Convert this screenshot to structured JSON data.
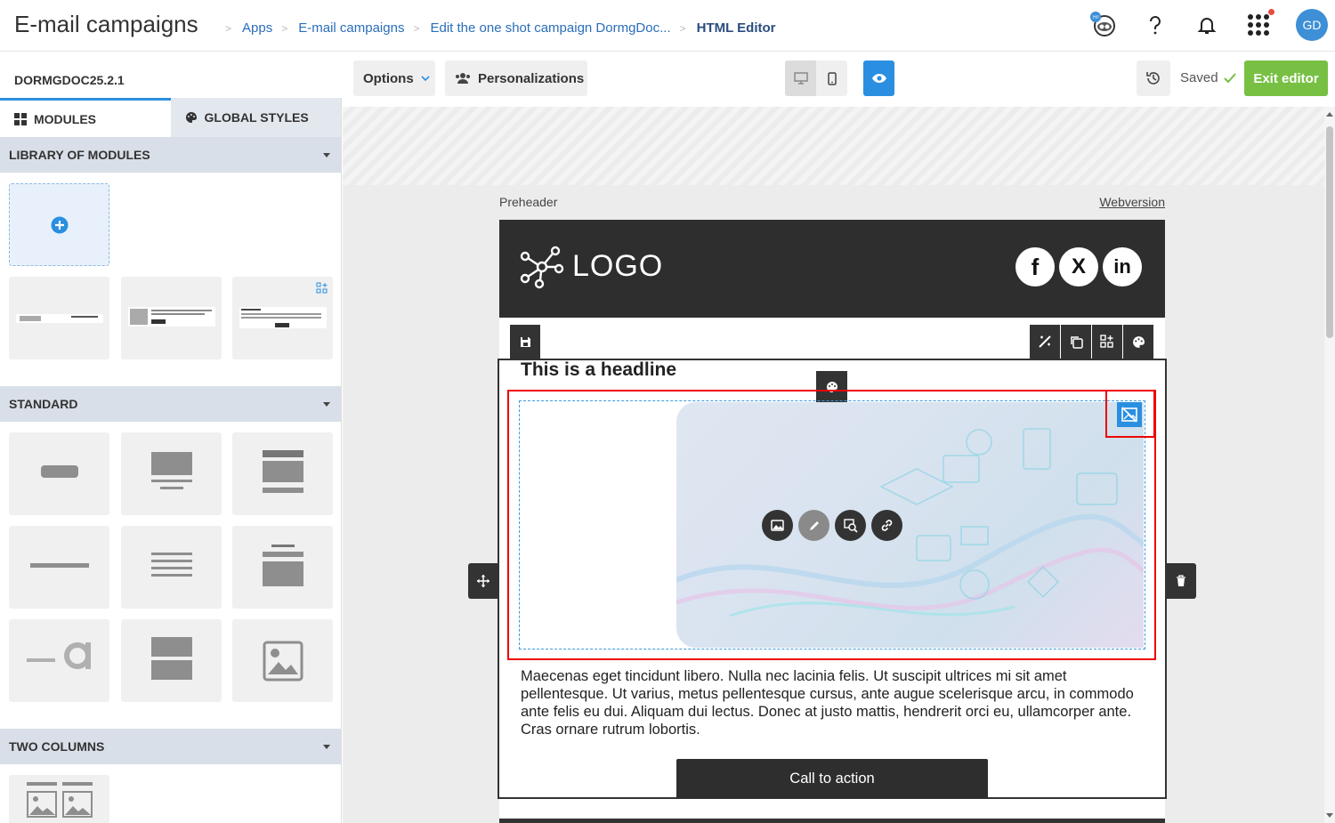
{
  "header": {
    "app_title": "E-mail campaigns",
    "breadcrumb": [
      "Apps",
      "E-mail campaigns",
      "Edit the one shot campaign DormgDoc...",
      "HTML Editor"
    ],
    "avatar_initials": "GD",
    "notification_badge_color": "#e74c3c"
  },
  "toolbar": {
    "campaign_code": "DORMGDOC25.2.1",
    "options_label": "Options",
    "personalizations_label": "Personalizations",
    "saved_label": "Saved",
    "exit_label": "Exit editor",
    "accent_color": "#2a8fe0",
    "exit_color": "#77c044"
  },
  "sidebar": {
    "tabs": [
      {
        "label": "MODULES",
        "icon": "grid-icon",
        "active": true
      },
      {
        "label": "GLOBAL STYLES",
        "icon": "palette-icon",
        "active": false
      }
    ],
    "sections": [
      "LIBRARY OF MODULES",
      "STANDARD",
      "TWO COLUMNS"
    ],
    "library_tiles": [
      {
        "caption": "Add a new module",
        "type": "add"
      },
      {
        "type": "thumbnail"
      },
      {
        "type": "thumbnail"
      },
      {
        "type": "thumbnail"
      }
    ],
    "standard_tiles": [
      "button",
      "image-text",
      "title-image-text",
      "divider",
      "text",
      "title-text-block",
      "spacer-text",
      "two-blocks",
      "image"
    ]
  },
  "email": {
    "preheader": "Preheader",
    "webversion": "Webversion",
    "logo_text": "LOGO",
    "social": [
      "f",
      "X",
      "in"
    ],
    "headline": "This is a headline",
    "body": "Maecenas eget tincidunt libero. Nulla nec lacinia felis. Ut suscipit ultrices mi sit amet pellentesque. Ut varius, metus pellentesque cursus, ante augue scelerisque arcu, in commodo ante felis eu dui. Aliquam dui lectus. Donec at justo mattis, hendrerit orci eu, ullamcorper ante. Cras ornare rutrum lobortis.",
    "cta_label": "Call to action"
  }
}
